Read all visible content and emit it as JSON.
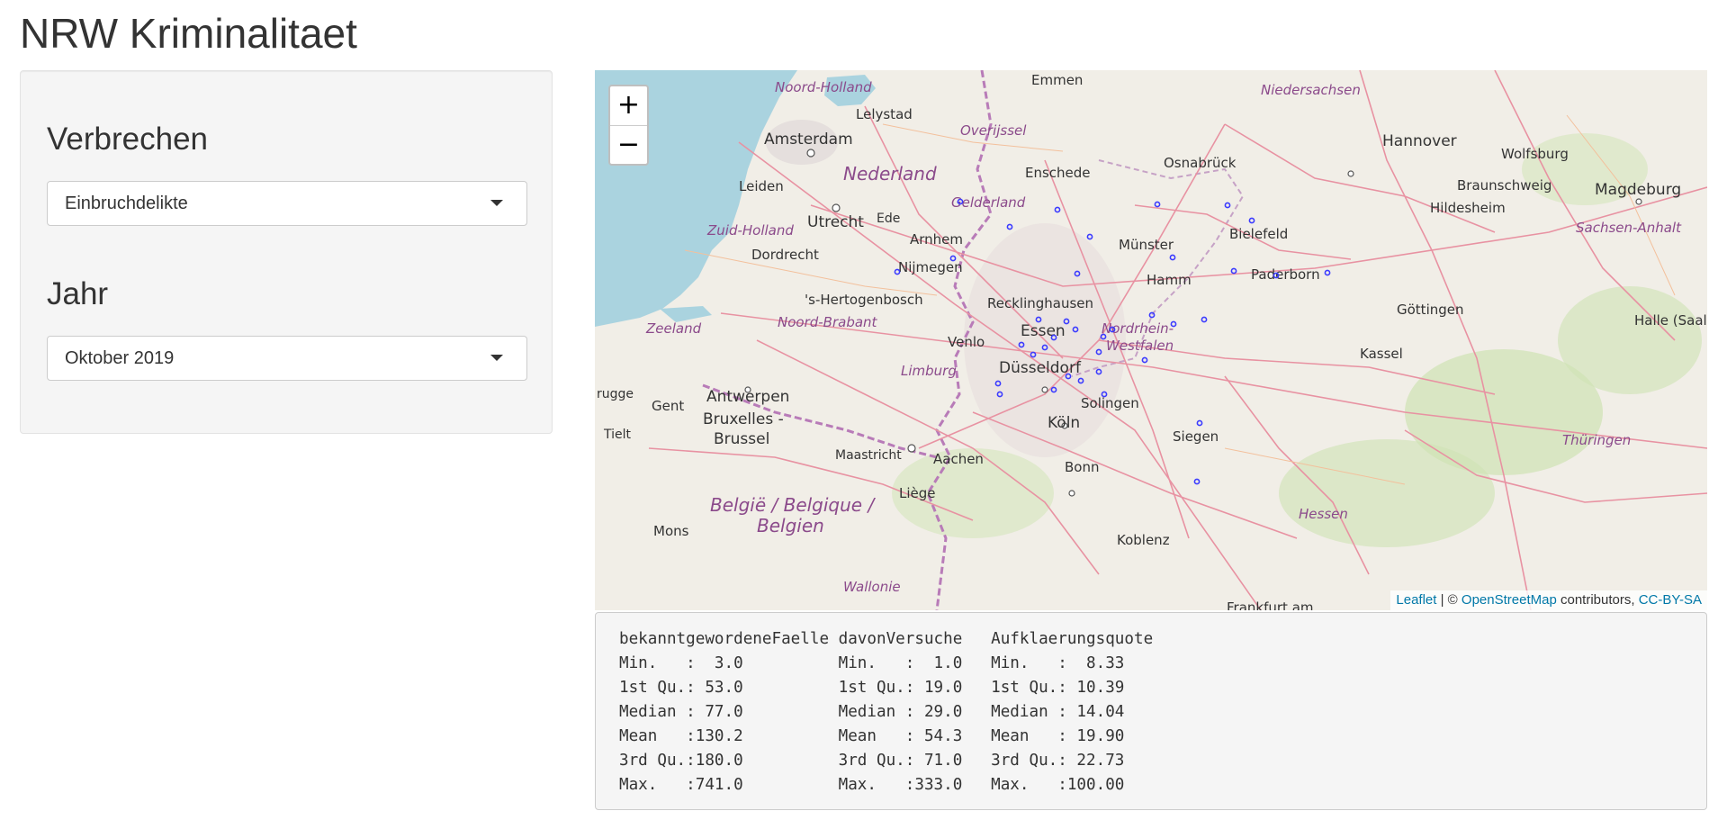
{
  "app": {
    "title": "NRW Kriminalitaet"
  },
  "sidebar": {
    "crime": {
      "label": "Verbrechen",
      "value": "Einbruchdelikte"
    },
    "year": {
      "label": "Jahr",
      "value": "Oktober 2019"
    }
  },
  "map": {
    "zoom_in": "+",
    "zoom_out": "−",
    "attribution": {
      "leaflet": "Leaflet",
      "separator": " | © ",
      "osm": "OpenStreetMap",
      "contributors": " contributors, ",
      "license": "CC-BY-SA"
    },
    "countries": [
      {
        "name": "Nederland"
      },
      {
        "name": "België / Belgique /"
      },
      {
        "name": "Belgien"
      }
    ],
    "regions": [
      "Noord-Holland",
      "Overijssel",
      "Gelderland",
      "Zuid-Holland",
      "Noord-Brabant",
      "Zeeland",
      "Limburg",
      "Niedersachsen",
      "Nordrhein-",
      "Westfalen",
      "Sachsen-Anhalt",
      "Thüringen",
      "Hessen",
      "Wallonie"
    ],
    "cities": [
      "Emmen",
      "Lelystad",
      "Amsterdam",
      "Leiden",
      "Utrecht",
      "Ede",
      "Arnhem",
      "Dordrecht",
      "Nijmegen",
      "'s-Hertogenbosch",
      "Enschede",
      "Osnabrück",
      "Hannover",
      "Wolfsburg",
      "Braunschweig",
      "Magdeburg",
      "Hildesheim",
      "Bielefeld",
      "Münster",
      "Hamm",
      "Paderborn",
      "Recklinghausen",
      "Essen",
      "Venlo",
      "Düsseldorf",
      "Solingen",
      "Köln",
      "Siegen",
      "Bonn",
      "Aachen",
      "Maastricht",
      "Liège",
      "Antwerpen",
      "Gent",
      "Bruxelles -",
      "Brussel",
      "Mons",
      "Tielt",
      "Göttingen",
      "Kassel",
      "Halle (Saal",
      "Koblenz",
      "Frankfurt am",
      "rugge"
    ],
    "marker_color": "#3b3bff"
  },
  "summary": {
    "rows": [
      "bekanntgewordeneFaelle davonVersuche   Aufklaerungsquote",
      "Min.   :  3.0          Min.   :  1.0   Min.   :  8.33   ",
      "1st Qu.: 53.0          1st Qu.: 19.0   1st Qu.: 10.39   ",
      "Median : 77.0          Median : 29.0   Median : 14.04   ",
      "Mean   :130.2          Mean   : 54.3   Mean   : 19.90   ",
      "3rd Qu.:180.0          3rd Qu.: 71.0   3rd Qu.: 22.73   ",
      "Max.   :741.0          Max.   :333.0   Max.   :100.00   "
    ]
  }
}
